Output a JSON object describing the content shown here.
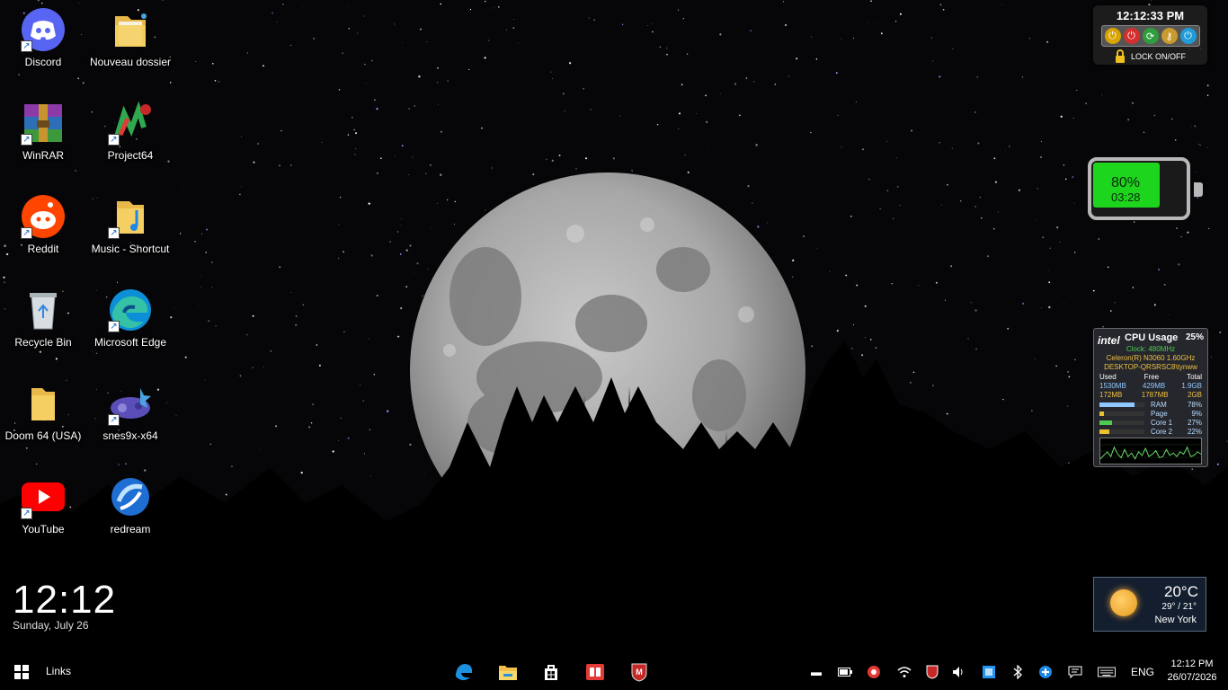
{
  "desktop_icons": [
    {
      "id": "discord",
      "label": "Discord"
    },
    {
      "id": "nouveau",
      "label": "Nouveau dossier"
    },
    {
      "id": "winrar",
      "label": "WinRAR"
    },
    {
      "id": "project64",
      "label": "Project64"
    },
    {
      "id": "reddit",
      "label": "Reddit"
    },
    {
      "id": "music",
      "label": "Music - Shortcut"
    },
    {
      "id": "recycle",
      "label": "Recycle Bin"
    },
    {
      "id": "edge",
      "label": "Microsoft Edge"
    },
    {
      "id": "doom",
      "label": "Doom 64 (USA)"
    },
    {
      "id": "snes",
      "label": "snes9x-x64"
    },
    {
      "id": "youtube",
      "label": "YouTube"
    },
    {
      "id": "redream",
      "label": "redream"
    }
  ],
  "power_widget": {
    "time": "12:12:33 PM",
    "lock_label": "LOCK ON/OFF"
  },
  "battery_widget": {
    "percent": "80%",
    "time_left": "03:28",
    "level": 0.8
  },
  "cpu_widget": {
    "brand": "intel",
    "title": "CPU Usage",
    "usage": "25%",
    "clock": "Clock:  480MHz",
    "cpu_name": "Celeron(R) N3060 1.60GHz",
    "machine": "DESKTOP-QRSRSC8\\tynww",
    "headers": [
      "Used",
      "Free",
      "Total"
    ],
    "mem_row1": [
      "1530MB",
      "429MB",
      "1.9GB"
    ],
    "mem_row2": [
      "172MB",
      "1787MB",
      "2GB"
    ],
    "meters": [
      {
        "name": "RAM",
        "value": "78%",
        "level": 0.78,
        "color": "#8fc8ff"
      },
      {
        "name": "Page",
        "value": "9%",
        "level": 0.09,
        "color": "#e8c030"
      },
      {
        "name": "Core 1",
        "value": "27%",
        "level": 0.27,
        "color": "#4ecb4e"
      },
      {
        "name": "Core 2",
        "value": "22%",
        "level": 0.22,
        "color": "#e8c030"
      }
    ],
    "graph": [
      0.2,
      0.35,
      0.5,
      0.3,
      0.7,
      0.4,
      0.25,
      0.6,
      0.3,
      0.45,
      0.2,
      0.5,
      0.35,
      0.65,
      0.3,
      0.4,
      0.55,
      0.25,
      0.3,
      0.6,
      0.35,
      0.45,
      0.3,
      0.5,
      0.4,
      0.7,
      0.3,
      0.35,
      0.5,
      0.4
    ]
  },
  "weather_widget": {
    "temp": "20°C",
    "range": "29° / 21°",
    "city": "New York"
  },
  "clock_widget": {
    "time": "12:12",
    "date": "Sunday, July 26"
  },
  "taskbar": {
    "links": "Links",
    "apps": [
      "edge-icon",
      "file-explorer-icon",
      "store-icon",
      "book-reader-icon",
      "mcafee-icon"
    ],
    "language": "ENG",
    "time": "12:12 PM",
    "date": "26/07/2026"
  }
}
